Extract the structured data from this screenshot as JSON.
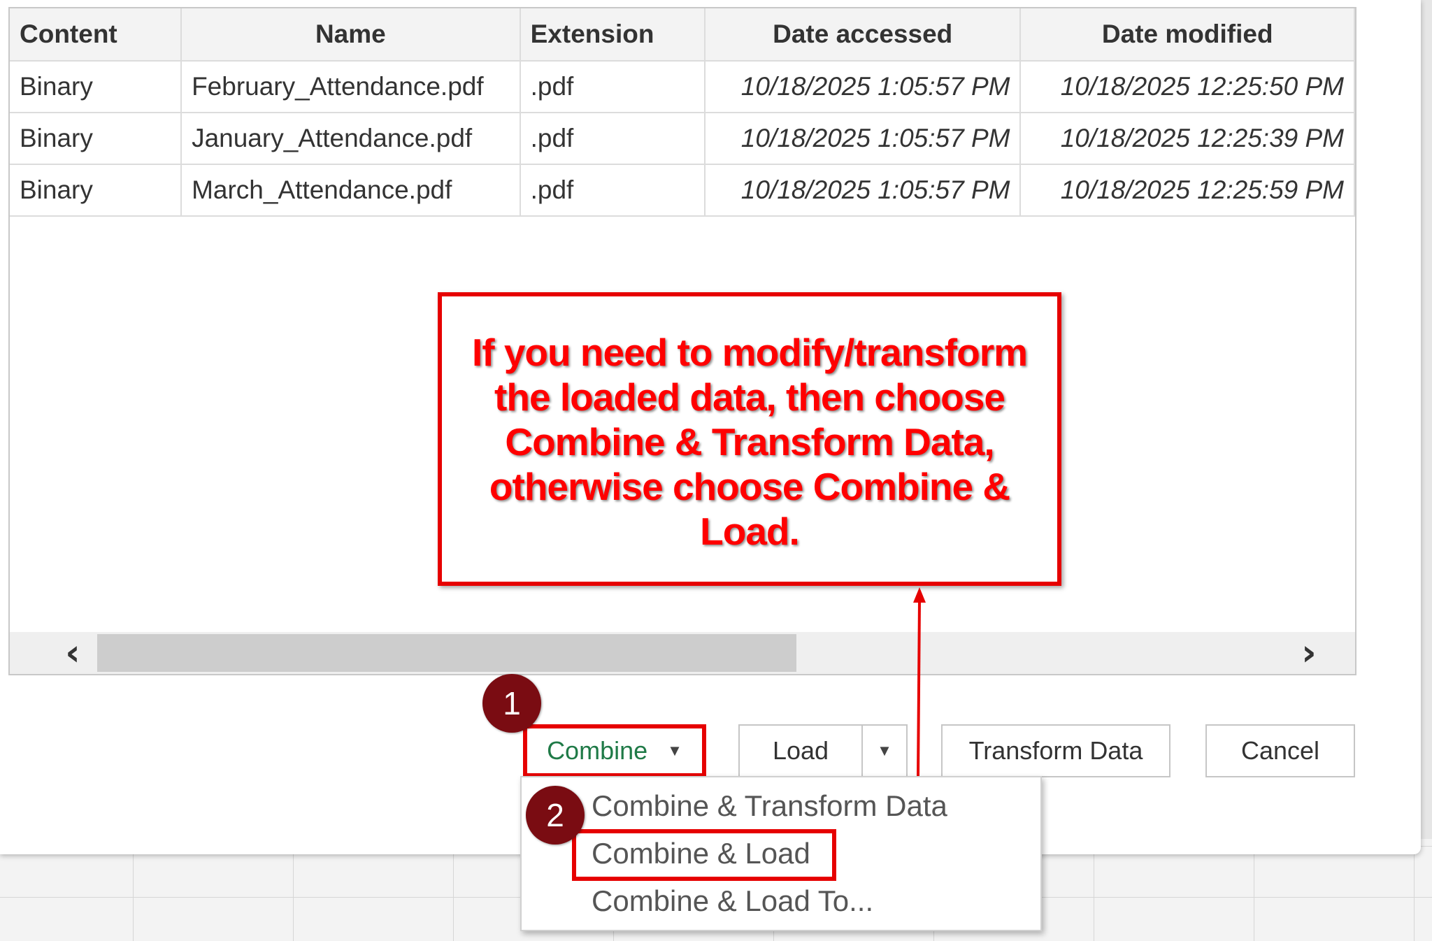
{
  "table": {
    "headers": [
      "Content",
      "Name",
      "Extension",
      "Date accessed",
      "Date modified"
    ],
    "rows": [
      [
        "Binary",
        "February_Attendance.pdf",
        ".pdf",
        "10/18/2025 1:05:57 PM",
        "10/18/2025 12:25:50 PM"
      ],
      [
        "Binary",
        "January_Attendance.pdf",
        ".pdf",
        "10/18/2025 1:05:57 PM",
        "10/18/2025 12:25:39 PM"
      ],
      [
        "Binary",
        "March_Attendance.pdf",
        ".pdf",
        "10/18/2025 1:05:57 PM",
        "10/18/2025 12:25:59 PM"
      ]
    ]
  },
  "scrollbar": {
    "left_icon": "chevron-left-icon",
    "right_icon": "chevron-right-icon"
  },
  "callout": {
    "text": "If you need to modify/transform the loaded data, then choose Combine & Transform Data, otherwise choose Combine & Load."
  },
  "buttons": {
    "combine": "Combine",
    "load": "Load",
    "transform": "Transform Data",
    "cancel": "Cancel"
  },
  "dropdown": {
    "items": [
      "Combine & Transform Data",
      "Combine & Load",
      "Combine & Load To..."
    ]
  },
  "badges": {
    "step1": "1",
    "step2": "2"
  },
  "colors": {
    "annotation_red": "#e60000",
    "badge": "#7a0c12",
    "combine_text": "#1f7a47"
  }
}
